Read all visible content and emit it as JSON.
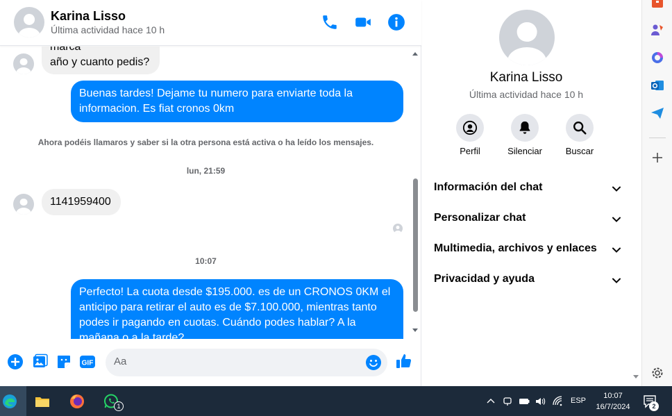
{
  "header": {
    "name": "Karina Lisso",
    "status": "Última actividad hace 10 h"
  },
  "messages": {
    "partial_in_line1": "marca",
    "partial_in_line2": "año y cuanto pedis?",
    "out1": "Buenas tardes! Dejame tu numero para enviarte toda la informacion. Es fiat cronos 0km",
    "system_notice": "Ahora podéis llamaros y saber si la otra persona está activa o ha leído los mensajes.",
    "timestamp1": "lun, 21:59",
    "in_phone": "1141959400",
    "timestamp2": "10:07",
    "out2": "Perfecto! La cuota desde $195.000. es de un CRONOS 0KM el anticipo para retirar el auto es de $7.100.000, mientras tanto podes ir pagando en cuotas. Cuándo podes hablar? A la mañana o a la tarde?"
  },
  "composer": {
    "placeholder": "Aa",
    "gif_label": "GIF"
  },
  "info": {
    "name": "Karina Lisso",
    "status": "Última actividad hace 10 h",
    "actions": [
      {
        "label": "Perfil",
        "icon": "profile-icon"
      },
      {
        "label": "Silenciar",
        "icon": "bell-icon"
      },
      {
        "label": "Buscar",
        "icon": "search-icon"
      }
    ],
    "sections": [
      "Información del chat",
      "Personalizar chat",
      "Multimedia, archivos y enlaces",
      "Privacidad y ayuda"
    ]
  },
  "taskbar": {
    "whatsapp_badge": "1",
    "language": "ESP",
    "time": "10:07",
    "date": "16/7/2024",
    "notification_count": "2"
  },
  "colors": {
    "accent": "#0084ff",
    "incoming_bubble": "#f0f0f0",
    "taskbar": "#1c2a3a"
  }
}
